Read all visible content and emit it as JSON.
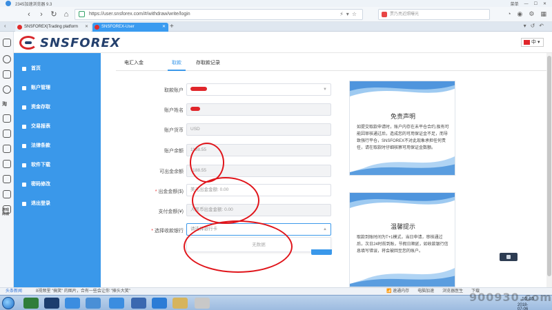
{
  "browser": {
    "app_title": "2345加速浏览器 9.3",
    "url": "https://user.snsforex.com/#/withdraw/write/login",
    "search_placeholder": "贾乃亮近照曝光",
    "title_right": [
      "菜单",
      "—",
      "☐",
      "✕"
    ],
    "tabs": [
      {
        "label": "SNSFOREX|Trading platform",
        "close": "✕"
      },
      {
        "label": "SNSFOREX-User",
        "close": "✕"
      }
    ],
    "new_tab": "+"
  },
  "browser_sidebar": {
    "text_items": [
      "淘",
      "游戏\n商城"
    ]
  },
  "site": {
    "logo_text": "SNSFOREX",
    "language": "中",
    "language_caret": "▾"
  },
  "side_menu": [
    "首页",
    "账户管理",
    "资金存取",
    "交易报表",
    "法律条款",
    "软件下载",
    "密码修改",
    "退出登录"
  ],
  "content_tabs": [
    "电汇入金",
    "取款",
    "存取款记录"
  ],
  "form": {
    "fields": [
      {
        "label": "取款账户",
        "value": "",
        "placeholder": "",
        "required": false
      },
      {
        "label": "账户姓名",
        "value": "",
        "placeholder": "",
        "required": false
      },
      {
        "label": "账户货币",
        "value": "USD",
        "placeholder": "",
        "required": false
      },
      {
        "label": "账户余额",
        "value": "1188.55",
        "placeholder": "",
        "required": false
      },
      {
        "label": "可出金余额",
        "value": "1188.55",
        "placeholder": "",
        "required": false
      },
      {
        "label": "出金金额($)",
        "value": "",
        "placeholder": "美元出金金额: 0.00",
        "required": true
      },
      {
        "label": "支付金额(¥)",
        "value": "",
        "placeholder": "人民币出金金额: 0.00",
        "required": false
      },
      {
        "label": "选择收款银行",
        "value": "",
        "placeholder": "请选择银行卡",
        "required": true
      }
    ],
    "dropdown_empty": "无数据",
    "required_mark": "*"
  },
  "cards": [
    {
      "title": "免责声明",
      "body": "如提交取款申请时，账户内存在未平仓合约,极有可能因审核通过后，造成您的可用保证金不足，而导致强行平仓，SNSFOREX不对此现象承担任何责任，请在取款时仔细核察可用保证金数额。"
    },
    {
      "title": "温馨提示",
      "body": "取款到账时间为T+1模式，当日申请，审核通过后，次日24时前到账，节假日顺延，如收款银行信息填写错误，将会被回至您的账户。"
    }
  ],
  "statusbar": {
    "news_tag": "头条新闻",
    "news": "8视频里 \"搞笑\" 的图片，合有一些会让你 \"捧头大笑\"",
    "right_items": [
      "📶 速通内存",
      "电脑加速",
      "浏览器医生",
      "下载"
    ]
  },
  "taskbar": {
    "time": "10:40",
    "date": "2018-07-06"
  },
  "watermark": "900930.com",
  "colors": {
    "menu_blue": "#3a98ea",
    "brand_red": "#d8262b",
    "brand_navy": "#24406d",
    "annotation_red": "#e0141a"
  }
}
